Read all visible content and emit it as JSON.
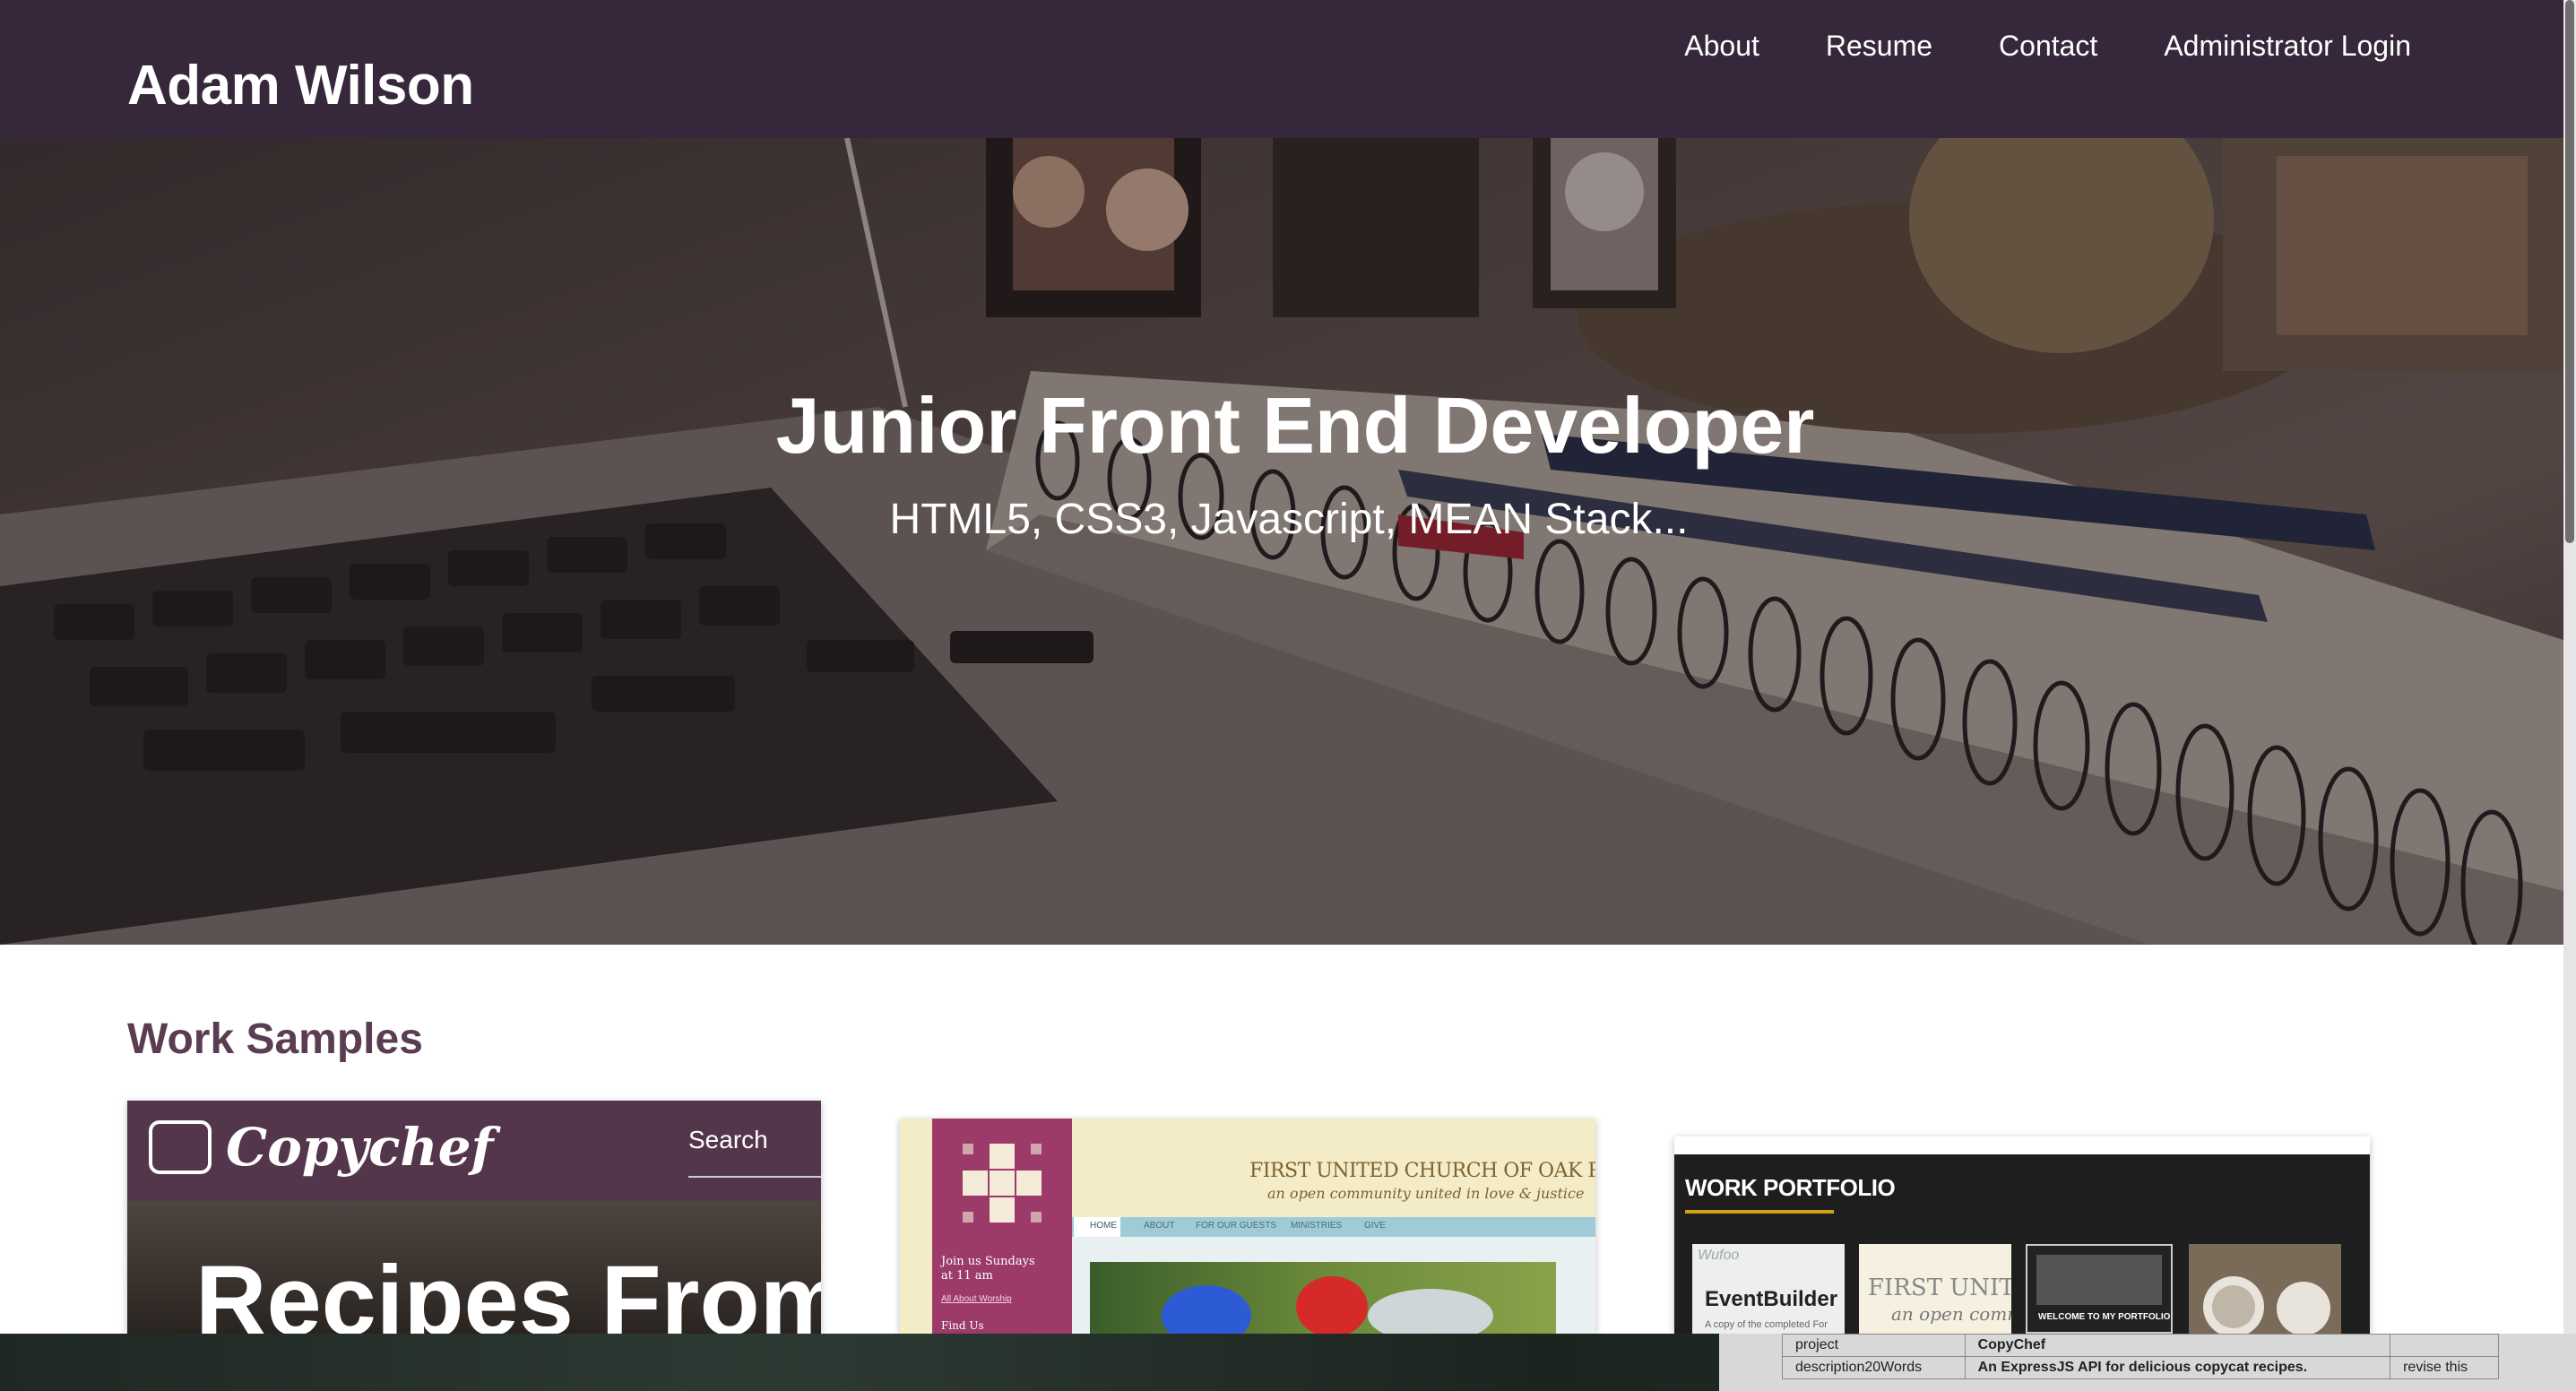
{
  "header": {
    "brand": "Adam Wilson",
    "nav": [
      "About",
      "Resume",
      "Contact",
      "Administrator Login"
    ]
  },
  "hero": {
    "title": "Junior Front End Developer",
    "subtitle": "HTML5, CSS3, Javascript, MEAN Stack..."
  },
  "work_samples": {
    "heading": "Work Samples",
    "cards": [
      {
        "logo": "Copychef",
        "search": "Search",
        "big_text": "Recipes From"
      },
      {
        "church_name": "FIRST UNITED CHURCH OF OAK PARK",
        "tagline": "an open community united in love & justice",
        "nav_items": [
          "HOME",
          "ABOUT",
          "FOR OUR GUESTS",
          "MINISTRIES",
          "GIVE"
        ],
        "join": "Join us Sundays",
        "join_time": "at 11 am",
        "worship_link": "All About Worship",
        "find_us": "Find Us"
      },
      {
        "title": "WORK PORTFOLIO",
        "thumb1": "EventBuilder",
        "thumb1_caption": "A copy of the completed For",
        "thumb1_brand": "Wufoo",
        "thumb2": "FIRST UNITED",
        "thumb2_sub": "an open commu",
        "thumb3": "WELCOME TO MY PORTFOLIO"
      }
    ]
  },
  "background_window": {
    "rows": [
      [
        "project",
        "CopyChef",
        ""
      ],
      [
        "description20Words",
        "An ExpressJS API for delicious copycat recipes.",
        "revise this"
      ]
    ]
  },
  "colors": {
    "header_bg": "#36273a",
    "section_heading": "#5a3d52",
    "copychef_bar": "#54364c",
    "church_accent": "#9c3a6a"
  }
}
